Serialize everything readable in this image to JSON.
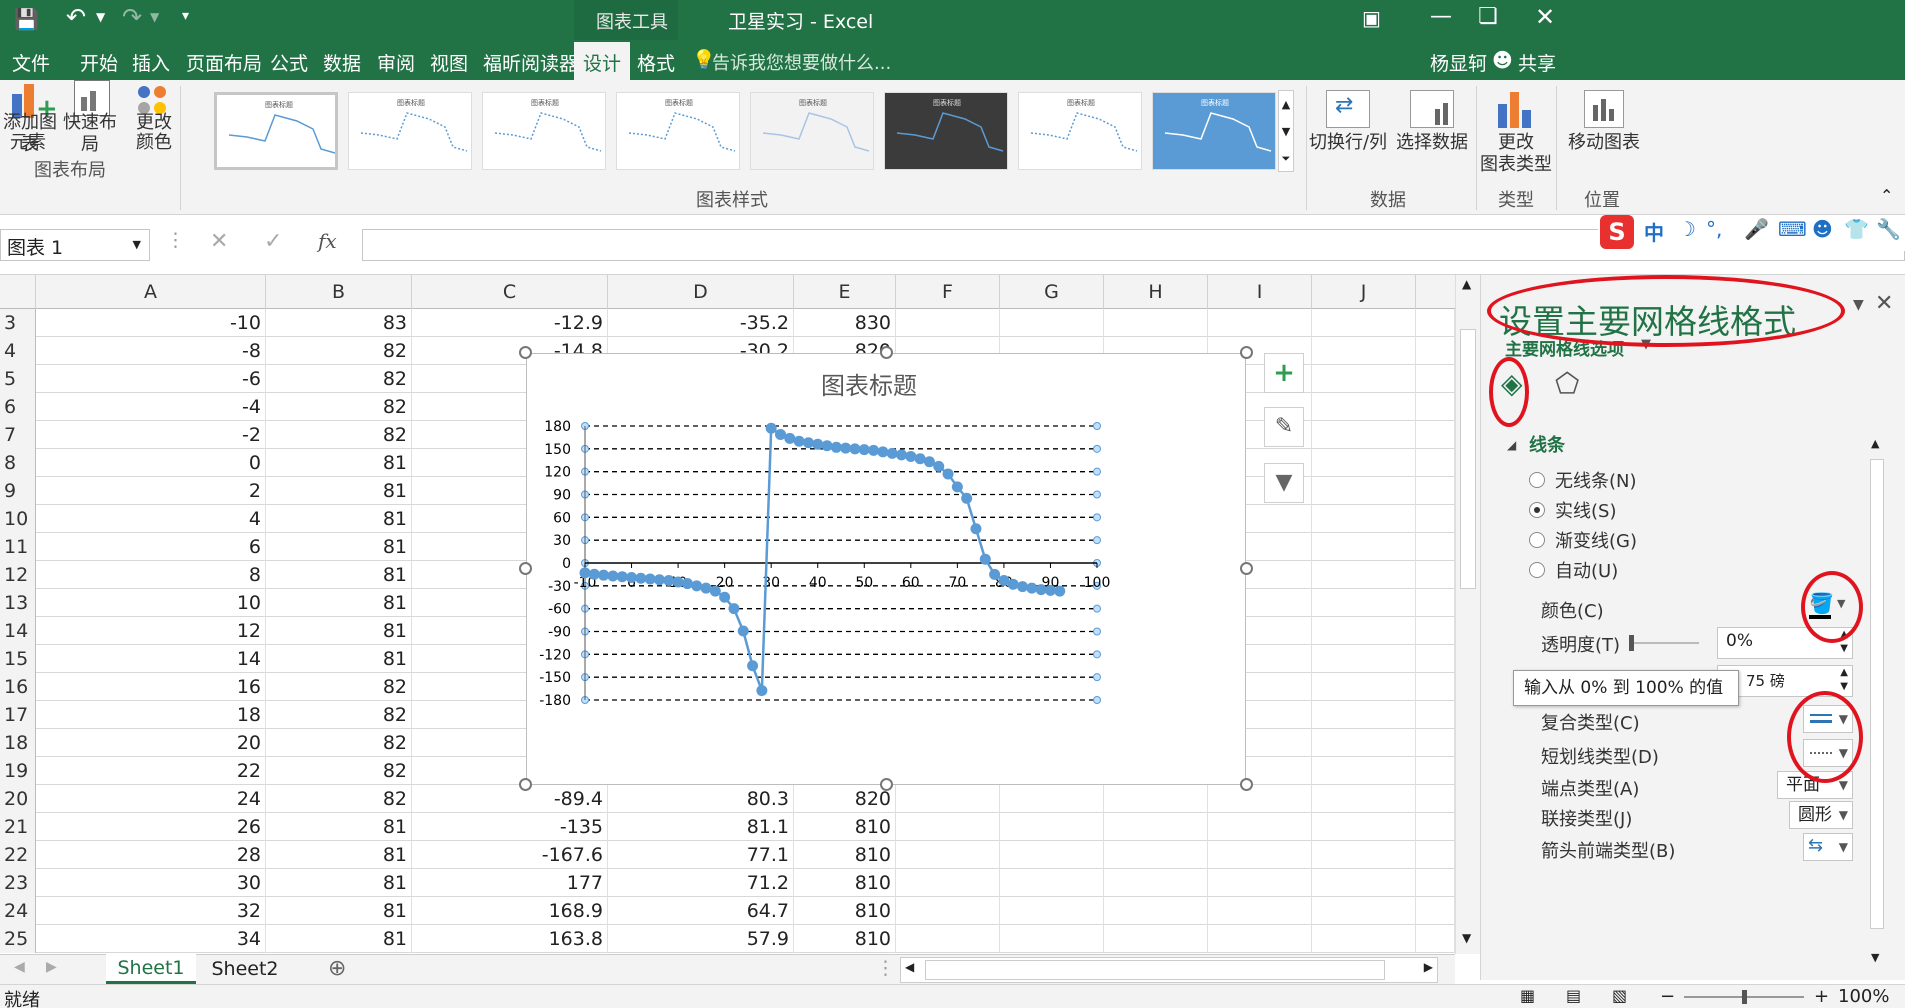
{
  "titlebar": {
    "tool_context": "图表工具",
    "title": "卫星实习 - Excel"
  },
  "menu": {
    "items": [
      "文件",
      "开始",
      "插入",
      "页面布局",
      "公式",
      "数据",
      "审阅",
      "视图",
      "福昕阅读器",
      "设计",
      "格式"
    ],
    "tell_me": "告诉我您想要做什么...",
    "user": "杨显轲",
    "share": "共享"
  },
  "ribbon": {
    "add_element_1": "添加图表",
    "add_element_2": "元素",
    "quick_layout": "快速布局",
    "change_colors_1": "更改",
    "change_colors_2": "颜色",
    "group_layout": "图表布局",
    "group_styles": "图表样式",
    "switch_row_col": "切换行/列",
    "select_data": "选择数据",
    "group_data": "数据",
    "change_type_1": "更改",
    "change_type_2": "图表类型",
    "group_type": "类型",
    "move_chart": "移动图表",
    "group_location": "位置",
    "thumb_title": "图表标题"
  },
  "formula_bar": {
    "name_box": "图表 1",
    "fx": "fx",
    "content": ""
  },
  "columns": [
    "A",
    "B",
    "C",
    "D",
    "E",
    "F",
    "G",
    "H",
    "I",
    "J"
  ],
  "rows": [
    {
      "n": "3",
      "a": "-10",
      "b": "83",
      "c": "-12.9",
      "d": "-35.2",
      "e": "830"
    },
    {
      "n": "4",
      "a": "-8",
      "b": "82",
      "c": "-14.8",
      "d": "-30.2",
      "e": "820"
    },
    {
      "n": "5",
      "a": "-6",
      "b": "82",
      "c": "",
      "d": "",
      "e": ""
    },
    {
      "n": "6",
      "a": "-4",
      "b": "82",
      "c": "",
      "d": "",
      "e": ""
    },
    {
      "n": "7",
      "a": "-2",
      "b": "82",
      "c": "",
      "d": "",
      "e": ""
    },
    {
      "n": "8",
      "a": "0",
      "b": "81",
      "c": "",
      "d": "",
      "e": ""
    },
    {
      "n": "9",
      "a": "2",
      "b": "81",
      "c": "",
      "d": "",
      "e": ""
    },
    {
      "n": "10",
      "a": "4",
      "b": "81",
      "c": "",
      "d": "",
      "e": ""
    },
    {
      "n": "11",
      "a": "6",
      "b": "81",
      "c": "",
      "d": "",
      "e": ""
    },
    {
      "n": "12",
      "a": "8",
      "b": "81",
      "c": "",
      "d": "",
      "e": ""
    },
    {
      "n": "13",
      "a": "10",
      "b": "81",
      "c": "",
      "d": "",
      "e": ""
    },
    {
      "n": "14",
      "a": "12",
      "b": "81",
      "c": "",
      "d": "",
      "e": ""
    },
    {
      "n": "15",
      "a": "14",
      "b": "81",
      "c": "",
      "d": "",
      "e": ""
    },
    {
      "n": "16",
      "a": "16",
      "b": "82",
      "c": "",
      "d": "",
      "e": ""
    },
    {
      "n": "17",
      "a": "18",
      "b": "82",
      "c": "",
      "d": "",
      "e": ""
    },
    {
      "n": "18",
      "a": "20",
      "b": "82",
      "c": "",
      "d": "",
      "e": ""
    },
    {
      "n": "19",
      "a": "22",
      "b": "82",
      "c": "",
      "d": "",
      "e": ""
    },
    {
      "n": "20",
      "a": "24",
      "b": "82",
      "c": "-89.4",
      "d": "80.3",
      "e": "820"
    },
    {
      "n": "21",
      "a": "26",
      "b": "81",
      "c": "-135",
      "d": "81.1",
      "e": "810"
    },
    {
      "n": "22",
      "a": "28",
      "b": "81",
      "c": "-167.6",
      "d": "77.1",
      "e": "810"
    },
    {
      "n": "23",
      "a": "30",
      "b": "81",
      "c": "177",
      "d": "71.2",
      "e": "810"
    },
    {
      "n": "24",
      "a": "32",
      "b": "81",
      "c": "168.9",
      "d": "64.7",
      "e": "810"
    },
    {
      "n": "25",
      "a": "34",
      "b": "81",
      "c": "163.8",
      "d": "57.9",
      "e": "810"
    }
  ],
  "sheets": {
    "active": "Sheet1",
    "other": "Sheet2"
  },
  "status": {
    "ready": "就绪",
    "zoom": "100%"
  },
  "chart_data": {
    "type": "scatter",
    "title": "图表标题",
    "xlim": [
      -10,
      100
    ],
    "ylim": [
      -180,
      180
    ],
    "xticks": [
      -10,
      0,
      10,
      20,
      30,
      40,
      50,
      60,
      70,
      80,
      90,
      100
    ],
    "yticks": [
      180,
      150,
      120,
      90,
      60,
      30,
      0,
      -30,
      -60,
      -90,
      -120,
      -150,
      -180
    ],
    "gridlines": "dashed",
    "series": [
      {
        "color": "#5b9bd5",
        "x": [
          -10,
          -8,
          -6,
          -4,
          -2,
          0,
          2,
          4,
          6,
          8,
          10,
          12,
          14,
          16,
          18,
          20,
          22,
          24,
          26,
          28,
          30,
          32,
          34,
          36,
          38,
          40,
          42,
          44,
          46,
          48,
          50,
          52,
          54,
          56,
          58,
          60,
          62,
          64,
          66,
          68,
          70,
          72,
          74,
          76,
          78,
          80,
          82,
          84,
          86,
          88,
          90,
          92
        ],
        "y": [
          -12.9,
          -14.8,
          -16,
          -17,
          -18,
          -19,
          -20,
          -21,
          -22,
          -23,
          -25,
          -27,
          -30,
          -33,
          -37,
          -45,
          -60,
          -89.4,
          -135,
          -167.6,
          177,
          168.9,
          163.8,
          160,
          158,
          156,
          154,
          152,
          151,
          150,
          149,
          148,
          146,
          144,
          142,
          140,
          137,
          133,
          127,
          117,
          100,
          85,
          45,
          5,
          -15,
          -23,
          -28,
          -31,
          -33,
          -35,
          -36,
          -37
        ]
      }
    ]
  },
  "format_pane": {
    "title": "设置主要网格线格式",
    "options": "主要网格线选项",
    "section": "线条",
    "no_line": "无线条(N)",
    "solid": "实线(S)",
    "gradient": "渐变线(G)",
    "auto": "自动(U)",
    "color": "颜色(C)",
    "transparency": "透明度(T)",
    "transparency_value": "0%",
    "width_value": "75 磅",
    "tooltip": "输入从 0% 到 100% 的值",
    "compound": "复合类型(C)",
    "dash": "短划线类型(D)",
    "cap": "端点类型(A)",
    "cap_value": "平面",
    "join": "联接类型(J)",
    "join_value": "圆形",
    "arrow_begin": "箭头前端类型(B)"
  },
  "ime": {
    "zh": "中"
  },
  "colors": {
    "excel_green": "#217346",
    "series_blue": "#5b9bd5",
    "annotation_red": "#e0141e"
  }
}
